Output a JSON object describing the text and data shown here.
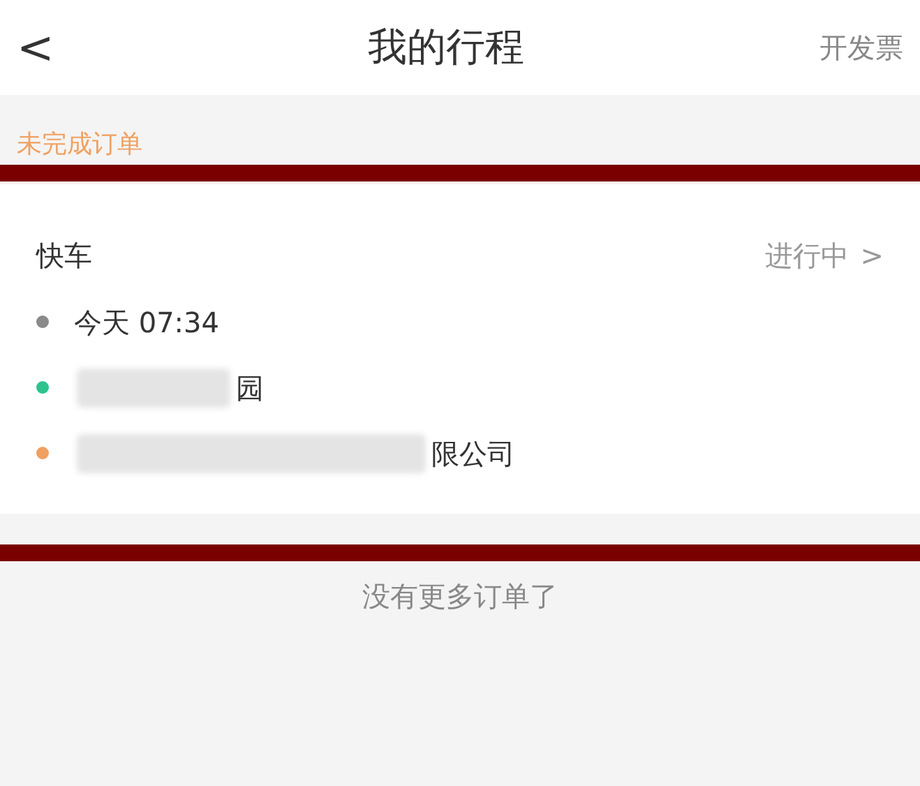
{
  "header": {
    "back": "<",
    "title": "我的行程",
    "action": "开发票"
  },
  "section_label": "未完成订单",
  "order": {
    "type": "快车",
    "status": "进行中",
    "status_arrow": ">",
    "stops": [
      {
        "kind": "time",
        "color": "#8a8a8a",
        "text": "今天 07:34"
      },
      {
        "kind": "redacted",
        "color": "#2cc38f",
        "text": "园"
      },
      {
        "kind": "redacted",
        "color": "#f0a060",
        "text": "限公司"
      }
    ]
  },
  "footer": "没有更多订单了"
}
